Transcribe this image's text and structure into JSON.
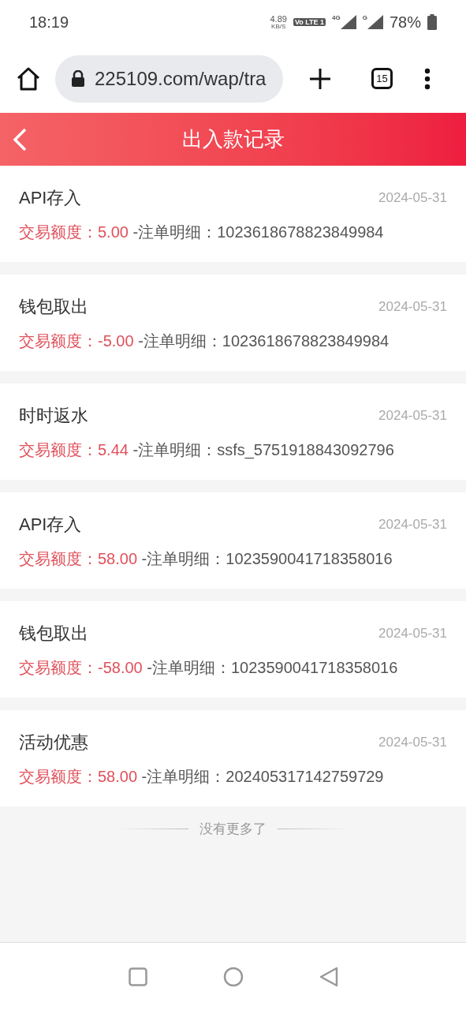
{
  "status_bar": {
    "time": "18:19",
    "net_speed": "4.89",
    "net_unit": "KB/S",
    "volte": "Vo LTE 1",
    "net_type_1": "4G",
    "net_type_2": "G",
    "battery": "78%"
  },
  "browser": {
    "url": "225109.com/wap/tra",
    "tab_count": "15"
  },
  "header": {
    "title": "出入款记录"
  },
  "records": [
    {
      "title": "API存入",
      "date": "2024-05-31",
      "amount_label": "交易额度：",
      "amount": "5.00",
      "detail_label": " -注单明细：",
      "order_id": "1023618678823849984"
    },
    {
      "title": "钱包取出",
      "date": "2024-05-31",
      "amount_label": "交易额度：",
      "amount": "-5.00",
      "detail_label": " -注单明细：",
      "order_id": "1023618678823849984"
    },
    {
      "title": "时时返水",
      "date": "2024-05-31",
      "amount_label": "交易额度：",
      "amount": "5.44",
      "detail_label": " -注单明细：",
      "order_id": "ssfs_5751918843092796"
    },
    {
      "title": "API存入",
      "date": "2024-05-31",
      "amount_label": "交易额度：",
      "amount": "58.00",
      "detail_label": " -注单明细：",
      "order_id": "1023590041718358016"
    },
    {
      "title": "钱包取出",
      "date": "2024-05-31",
      "amount_label": "交易额度：",
      "amount": "-58.00",
      "detail_label": " -注单明细：",
      "order_id": "1023590041718358016"
    },
    {
      "title": "活动优惠",
      "date": "2024-05-31",
      "amount_label": "交易额度：",
      "amount": "58.00",
      "detail_label": " -注单明细：",
      "order_id": "202405317142759729"
    }
  ],
  "end_text": "没有更多了"
}
